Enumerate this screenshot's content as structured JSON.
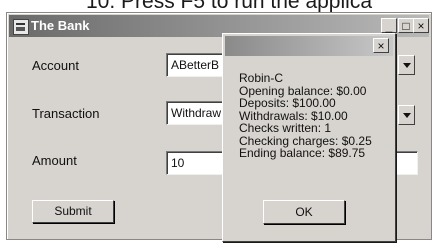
{
  "caption": "10. Press F5 to run the applica",
  "window": {
    "title": "The Bank",
    "minimize_glyph": "_",
    "maximize_glyph": "□",
    "close_glyph": "×"
  },
  "form": {
    "account_label": "Account",
    "account_value": "ABetterB",
    "transaction_label": "Transaction",
    "transaction_value": "Withdraw",
    "amount_label": "Amount",
    "amount_value": "10",
    "submit_label": "Submit"
  },
  "popup": {
    "close_glyph": "×",
    "lines": [
      "Robin-C",
      "Opening balance: $0.00",
      "Deposits: $100.00",
      "Withdrawals: $10.00",
      "Checks written: 1",
      "Checking charges: $0.25",
      "Ending balance: $89.75"
    ],
    "ok_label": "OK"
  },
  "colors": {
    "window_face": "#d7d4cf",
    "titlebar_dark": "#6a6a6a",
    "titlebar_light": "#b9b9b9"
  },
  "icons": {
    "app": "app-icon",
    "dropdown": "chevron-down-icon"
  }
}
